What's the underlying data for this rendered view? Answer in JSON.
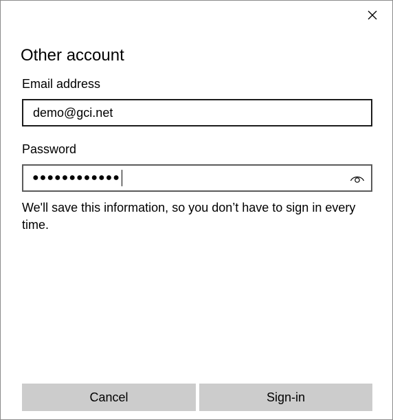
{
  "dialog": {
    "title": "Other account",
    "close_icon": "close-icon"
  },
  "email": {
    "label": "Email address",
    "value": "demo@gci.net"
  },
  "password": {
    "label": "Password",
    "masked_value": "●●●●●●●●●●●●",
    "reveal_icon": "eye-icon"
  },
  "info_text": "We'll save this information, so you don’t have to sign in every time.",
  "buttons": {
    "cancel_label": "Cancel",
    "signin_label": "Sign-in"
  },
  "colors": {
    "button_bg": "#cccccc",
    "border": "#1b1b1b"
  }
}
